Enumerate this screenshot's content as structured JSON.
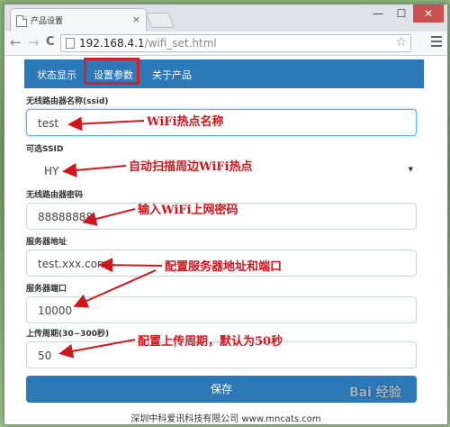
{
  "browser": {
    "tab_title": "产品设置",
    "tab_close": "×",
    "window_buttons": [
      "—",
      "☐",
      "✕"
    ],
    "back": "←",
    "forward": "→",
    "reload": "C",
    "url_host": "192.168.4.1",
    "url_path": "/wifi_set.html",
    "star": "☆"
  },
  "navbar": {
    "items": [
      "状态显示",
      "设置参数",
      "关于产品"
    ],
    "active": "设置参数"
  },
  "form": {
    "ssid_label": "无线路由器名称(ssid)",
    "ssid_value": "test",
    "optional_ssid_label": "可选SSID",
    "optional_ssid_value": "HY",
    "password_label": "无线路由器密码",
    "password_value": "88888888",
    "server_label": "服务器地址",
    "server_value": "test.xxx.com",
    "port_label": "服务器端口",
    "port_value": "10000",
    "period_label": "上传周期(30~300秒)",
    "period_value": "50",
    "save_label": "保存"
  },
  "footer": "深圳中科爱讯科技有限公司 www.mncats.com",
  "annotations": {
    "ssid": "WiFi热点名称",
    "optional": "自动扫描周边WiFi热点",
    "password": "输入WiFi上网密码",
    "server": "配置服务器地址和端口",
    "period": "配置上传周期，默认为50秒"
  },
  "watermark": "Bai 经验",
  "colors": {
    "navbar": "#2d79b7",
    "annotation": "#d2161e",
    "focus_border": "#66afe9"
  }
}
